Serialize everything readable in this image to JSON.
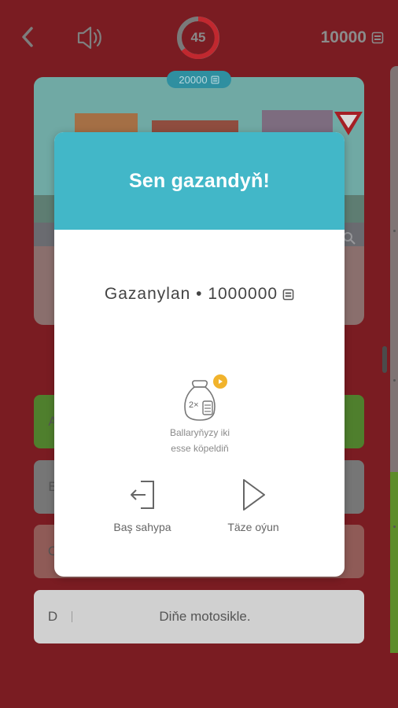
{
  "header": {
    "timer_value": "45",
    "coins_value": "10000",
    "prize_value": "20000",
    "icons": [
      "back-arrow-icon",
      "speaker-icon",
      "coin-icon"
    ]
  },
  "question": {
    "image_description_labels": []
  },
  "answers": [
    {
      "letter": "A",
      "text": "",
      "state": "correct-green"
    },
    {
      "letter": "B",
      "text": "",
      "state": "neutral"
    },
    {
      "letter": "C",
      "text": "",
      "state": "wrong-red"
    },
    {
      "letter": "D",
      "text": "Diňe motosikle.",
      "state": "light"
    }
  ],
  "modal": {
    "title": "Sen gazandyň!",
    "earned_label": "Gazanylan • 1000000",
    "double_text_line1": "Ballaryňyzy iki",
    "double_text_line2": "esse köpeldiň",
    "home_label": "Baş sahypa",
    "new_game_label": "Täze oýun"
  },
  "colors": {
    "background": "#7a1c22",
    "modal_header": "#42b7c8",
    "badge": "#f1b32c",
    "timer_ring": "#c1282f"
  }
}
